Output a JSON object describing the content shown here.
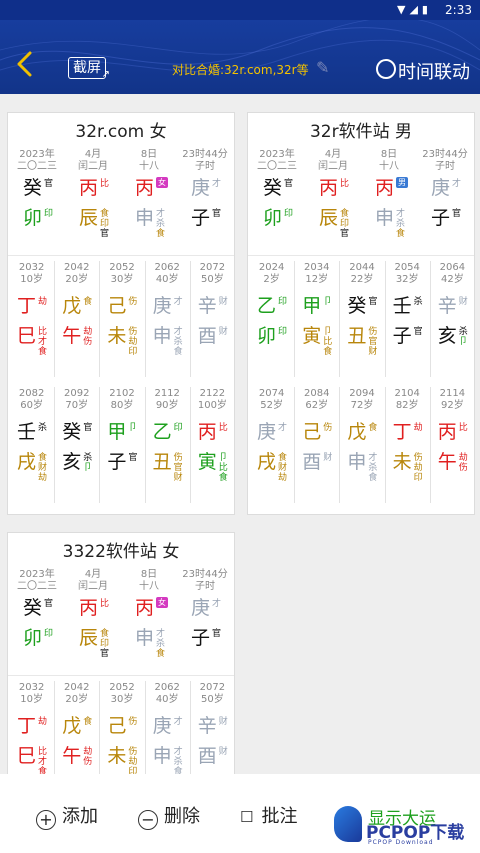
{
  "status": {
    "time": "2:33",
    "icons": "▼◢▮"
  },
  "header": {
    "back_icon": "chevron-left-icon",
    "screenshot_label": "截屏",
    "compare_text": "对比合婚:32r.com,32r等",
    "sync_label": "时间联动"
  },
  "colors": {
    "red": "#e02020",
    "green": "#1ea01e",
    "brown": "#b8860b",
    "gray": "#9aa5b5",
    "black": "#111111",
    "header": "#123489",
    "accent": "#f3c200"
  },
  "cards": [
    {
      "title": "32r.com 女",
      "pillars": [
        {
          "date1": "2023年",
          "date2": "二〇二三",
          "stem": "癸",
          "stem_color": "black",
          "stem_tag": "官",
          "branch": "卯",
          "branch_color": "green",
          "branch_tag": "印",
          "hidden": []
        },
        {
          "date1": "4月",
          "date2": "闰二月",
          "stem": "丙",
          "stem_color": "red",
          "stem_tag": "比",
          "branch": "辰",
          "branch_color": "brown",
          "branch_tag": "食",
          "hidden": [
            "印",
            "官"
          ]
        },
        {
          "date1": "8日",
          "date2": "十八",
          "stem": "丙",
          "stem_color": "red",
          "stem_tag": "",
          "badge": "女",
          "badge_color": "#d43ac0",
          "branch": "申",
          "branch_color": "gray",
          "branch_tag": "才",
          "hidden": [
            "杀",
            "食"
          ]
        },
        {
          "date1": "23时44分",
          "date2": "子时",
          "stem": "庚",
          "stem_color": "gray",
          "stem_tag": "才",
          "branch": "子",
          "branch_color": "black",
          "branch_tag": "官",
          "hidden": []
        }
      ],
      "dayun": [
        {
          "year": "2032",
          "age": "10岁",
          "stem": "丁",
          "sc": "red",
          "st": "劫",
          "branch": "巳",
          "bc": "red",
          "bt": "比",
          "h": [
            "才",
            "食"
          ]
        },
        {
          "year": "2042",
          "age": "20岁",
          "stem": "戊",
          "sc": "brown",
          "st": "食",
          "branch": "午",
          "bc": "red",
          "bt": "劫",
          "h": [
            "伤"
          ]
        },
        {
          "year": "2052",
          "age": "30岁",
          "stem": "己",
          "sc": "brown",
          "st": "伤",
          "branch": "未",
          "bc": "brown",
          "bt": "伤",
          "h": [
            "劫",
            "印"
          ]
        },
        {
          "year": "2062",
          "age": "40岁",
          "stem": "庚",
          "sc": "gray",
          "st": "才",
          "branch": "申",
          "bc": "gray",
          "bt": "才",
          "h": [
            "杀",
            "食"
          ]
        },
        {
          "year": "2072",
          "age": "50岁",
          "stem": "辛",
          "sc": "gray",
          "st": "财",
          "branch": "酉",
          "bc": "gray",
          "bt": "财",
          "h": []
        },
        {
          "year": "2082",
          "age": "60岁",
          "stem": "壬",
          "sc": "black",
          "st": "杀",
          "branch": "戌",
          "bc": "brown",
          "bt": "食",
          "h": [
            "财",
            "劫"
          ]
        },
        {
          "year": "2092",
          "age": "70岁",
          "stem": "癸",
          "sc": "black",
          "st": "官",
          "branch": "亥",
          "bc": "black",
          "bt": "杀",
          "h": [
            "卩"
          ]
        },
        {
          "year": "2102",
          "age": "80岁",
          "stem": "甲",
          "sc": "green",
          "st": "卩",
          "branch": "子",
          "bc": "black",
          "bt": "官",
          "h": []
        },
        {
          "year": "2112",
          "age": "90岁",
          "stem": "乙",
          "sc": "green",
          "st": "印",
          "branch": "丑",
          "bc": "brown",
          "bt": "伤",
          "h": [
            "官",
            "财"
          ]
        },
        {
          "year": "2122",
          "age": "100岁",
          "stem": "丙",
          "sc": "red",
          "st": "比",
          "branch": "寅",
          "bc": "green",
          "bt": "卩",
          "h": [
            "比",
            "食"
          ]
        }
      ]
    },
    {
      "title": "32r软件站 男",
      "pillars": [
        {
          "date1": "2023年",
          "date2": "二〇二三",
          "stem": "癸",
          "stem_color": "black",
          "stem_tag": "官",
          "branch": "卯",
          "branch_color": "green",
          "branch_tag": "印",
          "hidden": []
        },
        {
          "date1": "4月",
          "date2": "闰二月",
          "stem": "丙",
          "stem_color": "red",
          "stem_tag": "比",
          "branch": "辰",
          "branch_color": "brown",
          "branch_tag": "食",
          "hidden": [
            "印",
            "官"
          ]
        },
        {
          "date1": "8日",
          "date2": "十八",
          "stem": "丙",
          "stem_color": "red",
          "stem_tag": "",
          "badge": "男",
          "badge_color": "#3a7ad4",
          "branch": "申",
          "branch_color": "gray",
          "branch_tag": "才",
          "hidden": [
            "杀",
            "食"
          ]
        },
        {
          "date1": "23时44分",
          "date2": "子时",
          "stem": "庚",
          "stem_color": "gray",
          "stem_tag": "才",
          "branch": "子",
          "branch_color": "black",
          "branch_tag": "官",
          "hidden": []
        }
      ],
      "dayun": [
        {
          "year": "2024",
          "age": "2岁",
          "stem": "乙",
          "sc": "green",
          "st": "印",
          "branch": "卯",
          "bc": "green",
          "bt": "印",
          "h": []
        },
        {
          "year": "2034",
          "age": "12岁",
          "stem": "甲",
          "sc": "green",
          "st": "卩",
          "branch": "寅",
          "bc": "brown",
          "bt": "卩",
          "h": [
            "比",
            "食"
          ]
        },
        {
          "year": "2044",
          "age": "22岁",
          "stem": "癸",
          "sc": "black",
          "st": "官",
          "branch": "丑",
          "bc": "brown",
          "bt": "伤",
          "h": [
            "官",
            "财"
          ]
        },
        {
          "year": "2054",
          "age": "32岁",
          "stem": "壬",
          "sc": "black",
          "st": "杀",
          "branch": "子",
          "bc": "black",
          "bt": "官",
          "h": []
        },
        {
          "year": "2064",
          "age": "42岁",
          "stem": "辛",
          "sc": "gray",
          "st": "财",
          "branch": "亥",
          "bc": "black",
          "bt": "杀",
          "h": [
            "卩"
          ]
        },
        {
          "year": "2074",
          "age": "52岁",
          "stem": "庚",
          "sc": "gray",
          "st": "才",
          "branch": "戌",
          "bc": "brown",
          "bt": "食",
          "h": [
            "财",
            "劫"
          ]
        },
        {
          "year": "2084",
          "age": "62岁",
          "stem": "己",
          "sc": "brown",
          "st": "伤",
          "branch": "酉",
          "bc": "gray",
          "bt": "财",
          "h": []
        },
        {
          "year": "2094",
          "age": "72岁",
          "stem": "戊",
          "sc": "brown",
          "st": "食",
          "branch": "申",
          "bc": "gray",
          "bt": "才",
          "h": [
            "杀",
            "食"
          ]
        },
        {
          "year": "2104",
          "age": "82岁",
          "stem": "丁",
          "sc": "red",
          "st": "劫",
          "branch": "未",
          "bc": "brown",
          "bt": "伤",
          "h": [
            "劫",
            "印"
          ]
        },
        {
          "year": "2114",
          "age": "92岁",
          "stem": "丙",
          "sc": "red",
          "st": "比",
          "branch": "午",
          "bc": "red",
          "bt": "劫",
          "h": [
            "伤"
          ]
        }
      ]
    },
    {
      "title": "3322软件站 女",
      "pillars": [
        {
          "date1": "2023年",
          "date2": "二〇二三",
          "stem": "癸",
          "stem_color": "black",
          "stem_tag": "官",
          "branch": "卯",
          "branch_color": "green",
          "branch_tag": "印",
          "hidden": []
        },
        {
          "date1": "4月",
          "date2": "闰二月",
          "stem": "丙",
          "stem_color": "red",
          "stem_tag": "比",
          "branch": "辰",
          "branch_color": "brown",
          "branch_tag": "食",
          "hidden": [
            "印",
            "官"
          ]
        },
        {
          "date1": "8日",
          "date2": "十八",
          "stem": "丙",
          "stem_color": "red",
          "stem_tag": "",
          "badge": "女",
          "badge_color": "#d43ac0",
          "branch": "申",
          "branch_color": "gray",
          "branch_tag": "才",
          "hidden": [
            "杀",
            "食"
          ]
        },
        {
          "date1": "23时44分",
          "date2": "子时",
          "stem": "庚",
          "stem_color": "gray",
          "stem_tag": "才",
          "branch": "子",
          "branch_color": "black",
          "branch_tag": "官",
          "hidden": []
        }
      ],
      "dayun": [
        {
          "year": "2032",
          "age": "10岁",
          "stem": "丁",
          "sc": "red",
          "st": "劫",
          "branch": "巳",
          "bc": "red",
          "bt": "比",
          "h": [
            "才",
            "食"
          ]
        },
        {
          "year": "2042",
          "age": "20岁",
          "stem": "戊",
          "sc": "brown",
          "st": "食",
          "branch": "午",
          "bc": "red",
          "bt": "劫",
          "h": [
            "伤"
          ]
        },
        {
          "year": "2052",
          "age": "30岁",
          "stem": "己",
          "sc": "brown",
          "st": "伤",
          "branch": "未",
          "bc": "brown",
          "bt": "伤",
          "h": [
            "劫",
            "印"
          ]
        },
        {
          "year": "2062",
          "age": "40岁",
          "stem": "庚",
          "sc": "gray",
          "st": "才",
          "branch": "申",
          "bc": "gray",
          "bt": "才",
          "h": [
            "杀",
            "食"
          ]
        },
        {
          "year": "2072",
          "age": "50岁",
          "stem": "辛",
          "sc": "gray",
          "st": "财",
          "branch": "酉",
          "bc": "gray",
          "bt": "财",
          "h": []
        }
      ]
    }
  ],
  "bottom": {
    "add_label": "添加",
    "delete_label": "删除",
    "note_label": "批注",
    "show_dayun_label": "显示大运",
    "watermark_text": "PCPOP下载",
    "watermark_sub": "PCPOP Download"
  }
}
